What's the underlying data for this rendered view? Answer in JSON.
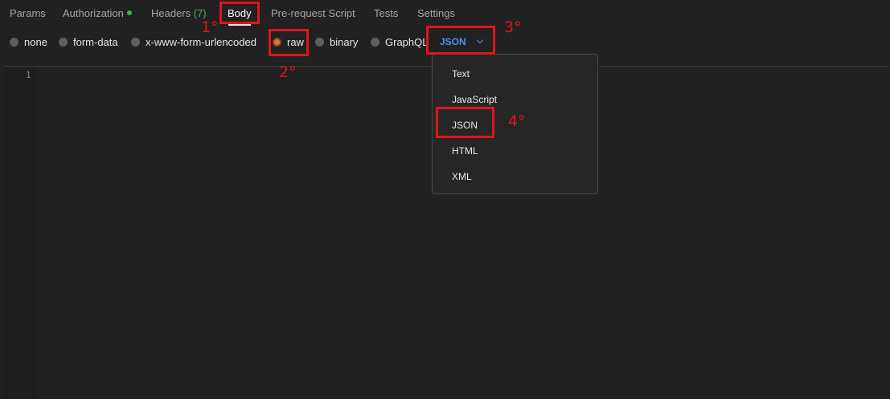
{
  "tabs": {
    "params": "Params",
    "authorization": "Authorization",
    "headers": "Headers",
    "headers_count": "(7)",
    "body": "Body",
    "pre_request": "Pre-request Script",
    "tests": "Tests",
    "settings": "Settings"
  },
  "body_options": {
    "none": "none",
    "form_data": "form-data",
    "urlencoded": "x-www-form-urlencoded",
    "raw": "raw",
    "binary": "binary",
    "graphql": "GraphQL",
    "selected": "raw"
  },
  "language_select": {
    "value": "JSON",
    "options": [
      "Text",
      "JavaScript",
      "JSON",
      "HTML",
      "XML"
    ]
  },
  "editor": {
    "line_numbers": [
      "1"
    ]
  },
  "annotations": [
    "1°",
    "2°",
    "3°",
    "4°"
  ],
  "colors": {
    "accent_blue": "#4d8dff",
    "radio_selected": "#ff6c37",
    "annotation_red": "#e0141c",
    "status_green": "#3bb55c"
  }
}
